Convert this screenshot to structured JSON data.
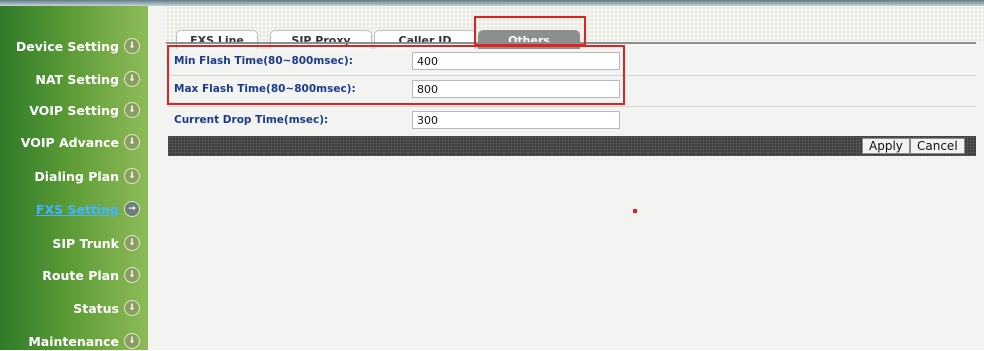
{
  "sidebar": {
    "items": [
      {
        "label": "Device Setting",
        "icon": "arrow-down-circle-icon"
      },
      {
        "label": "NAT Setting",
        "icon": "arrow-down-circle-icon"
      },
      {
        "label": "VOIP Setting",
        "icon": "arrow-down-circle-icon"
      },
      {
        "label": "VOIP Advance",
        "icon": "arrow-down-circle-icon"
      },
      {
        "label": "Dialing Plan",
        "icon": "arrow-down-circle-icon"
      },
      {
        "label": "FXS Setting",
        "icon": "arrow-right-circle-icon",
        "active": true
      },
      {
        "label": "SIP Trunk",
        "icon": "arrow-down-circle-icon"
      },
      {
        "label": "Route Plan",
        "icon": "arrow-down-circle-icon"
      },
      {
        "label": "Status",
        "icon": "arrow-down-circle-icon"
      },
      {
        "label": "Maintenance",
        "icon": "arrow-down-circle-icon"
      }
    ],
    "icon_glyph_down": "⇓",
    "icon_glyph_right": "→"
  },
  "tabs": [
    {
      "label": "FXS Line"
    },
    {
      "label": "SIP Proxy"
    },
    {
      "label": "Caller ID"
    },
    {
      "label": "Others",
      "active": true
    }
  ],
  "form": {
    "min_flash": {
      "label": "Min Flash Time(80~800msec):",
      "value": "400"
    },
    "max_flash": {
      "label": "Max Flash Time(80~800msec):",
      "value": "800"
    },
    "current_drop": {
      "label": "Current Drop Time(msec):",
      "value": "300"
    }
  },
  "buttons": {
    "apply": "Apply",
    "cancel": "Cancel"
  },
  "colors": {
    "sidebar_green": "#5a9a35",
    "active_link": "#44b4ff",
    "label_blue": "#1a3a8a",
    "highlight_red": "#e02222",
    "active_tab": "#8e8e8e"
  }
}
